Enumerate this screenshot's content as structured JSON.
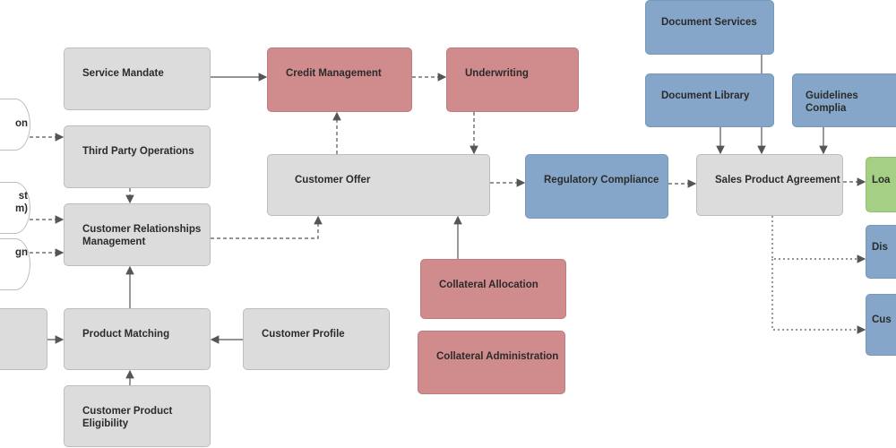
{
  "colors": {
    "core": "#dcdcdc",
    "credit": "#d08c8c",
    "compliance": "#85a6c8",
    "loan": "#a5cf85"
  },
  "nodes": {
    "service_mandate": "Service Mandate",
    "third_party_operations": "Third Party Operations",
    "crm": "Customer Relationships Management",
    "product_matching": "Product Matching",
    "customer_product_eligibility": "Customer Product Eligibility",
    "customer_profile": "Customer Profile",
    "credit_management": "Credit Management",
    "underwriting": "Underwriting",
    "customer_offer": "Customer Offer",
    "collateral_allocation": "Collateral Allocation",
    "collateral_administration": "Collateral Administration",
    "regulatory_compliance": "Regulatory Compliance",
    "document_services": "Document Services",
    "document_library": "Document Library",
    "guidelines_compliance": "Guidelines Complia",
    "sales_product_agreement": "Sales Product Agreement",
    "loan_partial": "Loa",
    "dis_partial": "Dis",
    "cus_partial": "Cus"
  },
  "ovals": {
    "oval1": "on",
    "oval2_line1": "st",
    "oval2_line2": "m)",
    "oval3": "gn"
  }
}
